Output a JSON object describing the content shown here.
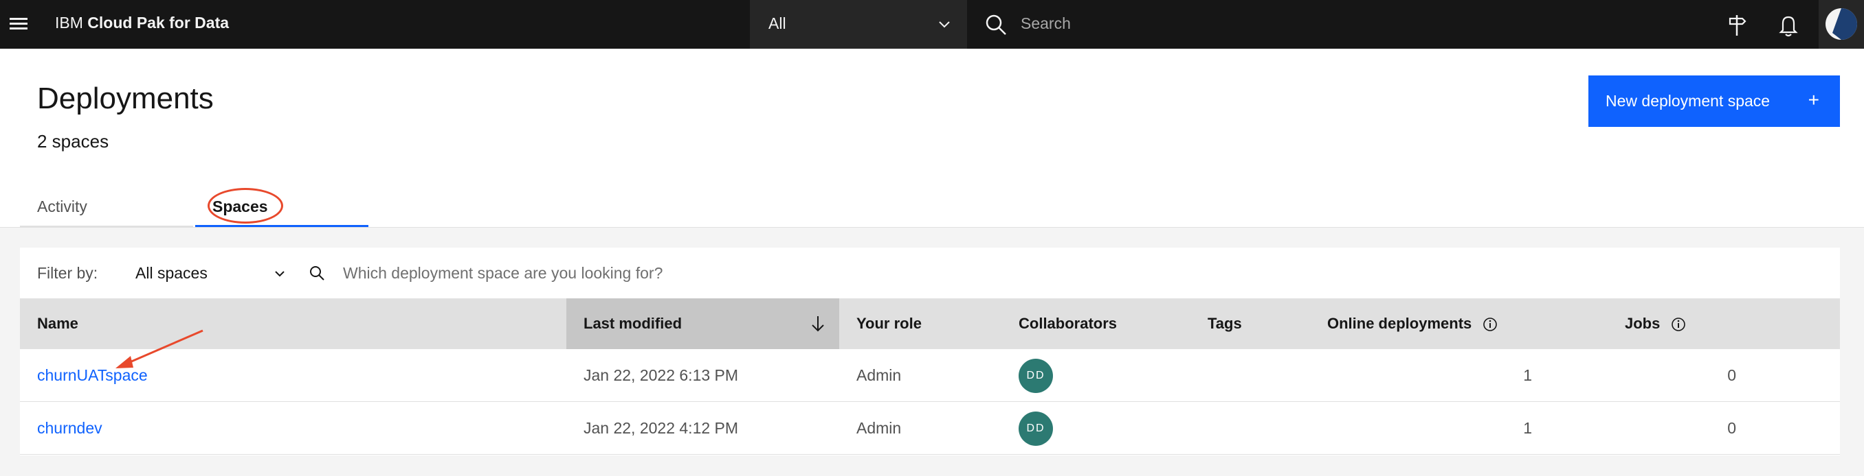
{
  "topbar": {
    "brand_prefix": "IBM",
    "brand_name": "Cloud Pak for Data",
    "scope_value": "All",
    "search_placeholder": "Search",
    "icons": [
      "menu-icon",
      "chevron-down-icon",
      "search-icon",
      "signpost-icon",
      "notification-icon",
      "avatar"
    ]
  },
  "header": {
    "title": "Deployments",
    "count": "2 spaces",
    "new_button_label": "New deployment space",
    "new_button_icon": "+"
  },
  "tabs": [
    {
      "label": "Activity",
      "selected": false
    },
    {
      "label": "Spaces",
      "selected": true
    }
  ],
  "filter": {
    "label": "Filter by:",
    "selected": "All spaces",
    "search_placeholder": "Which deployment space are you looking for?"
  },
  "table": {
    "columns": [
      "Name",
      "Last modified",
      "Your role",
      "Collaborators",
      "Tags",
      "Online deployments",
      "Jobs"
    ],
    "sorted_column": "Last modified",
    "sort_direction": "descending",
    "rows": [
      {
        "name": "churnUATspace",
        "last_modified": "Jan 22, 2022 6:13 PM",
        "role": "Admin",
        "collaborator_initials": "DD",
        "tags": "",
        "online_deployments": "1",
        "jobs": "0"
      },
      {
        "name": "churndev",
        "last_modified": "Jan 22, 2022 4:12 PM",
        "role": "Admin",
        "collaborator_initials": "DD",
        "tags": "",
        "online_deployments": "1",
        "jobs": "0"
      }
    ]
  },
  "colors": {
    "topbar_bg": "#161616",
    "primary": "#0f62fe",
    "annotation": "#e8492c",
    "avatar_bg": "#2c7a72"
  }
}
